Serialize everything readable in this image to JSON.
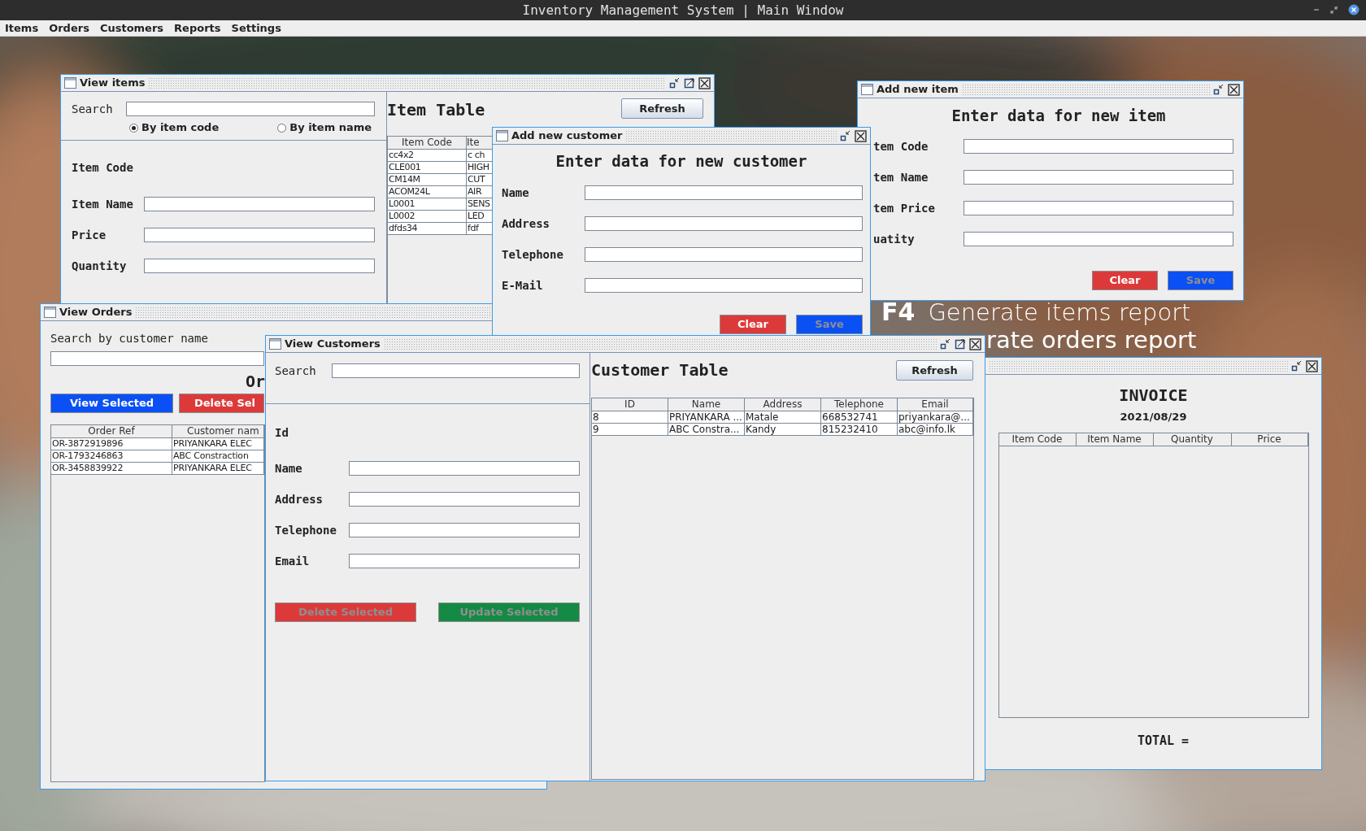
{
  "window": {
    "title": "Inventory Management System | Main Window"
  },
  "menu": [
    {
      "label": "Items"
    },
    {
      "label": "Orders"
    },
    {
      "label": "Customers"
    },
    {
      "label": "Reports"
    },
    {
      "label": "Settings"
    }
  ],
  "wallpaper_texts": [
    "F4",
    "Generate items report",
    "rate orders report"
  ],
  "view_items": {
    "title": "View items",
    "search_label": "Search",
    "search_options": [
      {
        "label": "By item code",
        "selected": true
      },
      {
        "label": "By item name",
        "selected": false
      }
    ],
    "fields": [
      {
        "label": "Item Code",
        "kind": "display"
      },
      {
        "label": "Item Name",
        "kind": "input"
      },
      {
        "label": "Price",
        "kind": "input"
      },
      {
        "label": "Quantity",
        "kind": "input"
      }
    ],
    "table_title": "Item Table",
    "refresh": "Refresh",
    "table": {
      "columns": [
        "Item Code",
        "Ite"
      ],
      "rows": [
        [
          "cc4x2",
          "c ch"
        ],
        [
          "CLE001",
          "HIGH"
        ],
        [
          "CM14M",
          "CUT"
        ],
        [
          "ACOM24L",
          "AIR"
        ],
        [
          "L0001",
          "SENS"
        ],
        [
          "L0002",
          "LED"
        ],
        [
          "dfds34",
          "fdf"
        ]
      ]
    }
  },
  "view_orders": {
    "title": "View Orders",
    "search_label": "Search by customer name",
    "heading": "Or",
    "buttons": [
      {
        "label": "View Selected",
        "color": "#0a50f5",
        "disabled": false
      },
      {
        "label": "Delete Sel",
        "color": "#dc3a3a",
        "disabled": false
      }
    ],
    "table": {
      "columns": [
        "Order Ref",
        "Customer nam"
      ],
      "rows": [
        [
          "OR-3872919896",
          "PRIYANKARA ELEC"
        ],
        [
          "OR-1793246863",
          "ABC Constraction"
        ],
        [
          "OR-3458839922",
          "PRIYANKARA ELEC"
        ]
      ]
    }
  },
  "add_customer": {
    "title": "Add new customer",
    "heading": "Enter data for new customer",
    "fields": [
      "Name",
      "Address",
      "Telephone",
      "E-Mail"
    ],
    "buttons": [
      {
        "label": "Clear",
        "color": "#dc3a3a",
        "disabled": false
      },
      {
        "label": "Save",
        "color": "#0a50f5",
        "disabled": true
      }
    ]
  },
  "add_item": {
    "title": "Add new item",
    "heading": "Enter data for new item",
    "fields": [
      "tem Code",
      "tem Name",
      "tem Price",
      "uatity"
    ],
    "buttons": [
      {
        "label": "Clear",
        "color": "#dc3a3a",
        "disabled": false
      },
      {
        "label": "Save",
        "color": "#0a50f5",
        "disabled": true
      }
    ]
  },
  "invoice": {
    "heading": "INVOICE",
    "date": "2021/08/29",
    "table": {
      "columns": [
        "Item Code",
        "Item Name",
        "Quantity",
        "Price"
      ]
    },
    "total_label": "TOTAL ="
  },
  "view_customers": {
    "title": "View Customers",
    "search_label": "Search",
    "fields": [
      {
        "label": "Id",
        "kind": "display"
      },
      {
        "label": "Name",
        "kind": "input"
      },
      {
        "label": "Address",
        "kind": "input"
      },
      {
        "label": "Telephone",
        "kind": "input"
      },
      {
        "label": "Email",
        "kind": "input"
      }
    ],
    "buttons": [
      {
        "label": "Delete Selected",
        "color": "#dc3a3a",
        "disabled": true
      },
      {
        "label": "Update Selected",
        "color": "#148a45",
        "disabled": true
      }
    ],
    "table_title": "Customer Table",
    "refresh": "Refresh",
    "table": {
      "columns": [
        "ID",
        "Name",
        "Address",
        "Telephone",
        "Email"
      ],
      "rows": [
        [
          "8",
          "PRIYANKARA ...",
          "Matale",
          "668532741",
          "priyankara@..."
        ],
        [
          "9",
          "ABC Constra...",
          "Kandy",
          "815232410",
          "abc@info.lk"
        ]
      ]
    }
  }
}
